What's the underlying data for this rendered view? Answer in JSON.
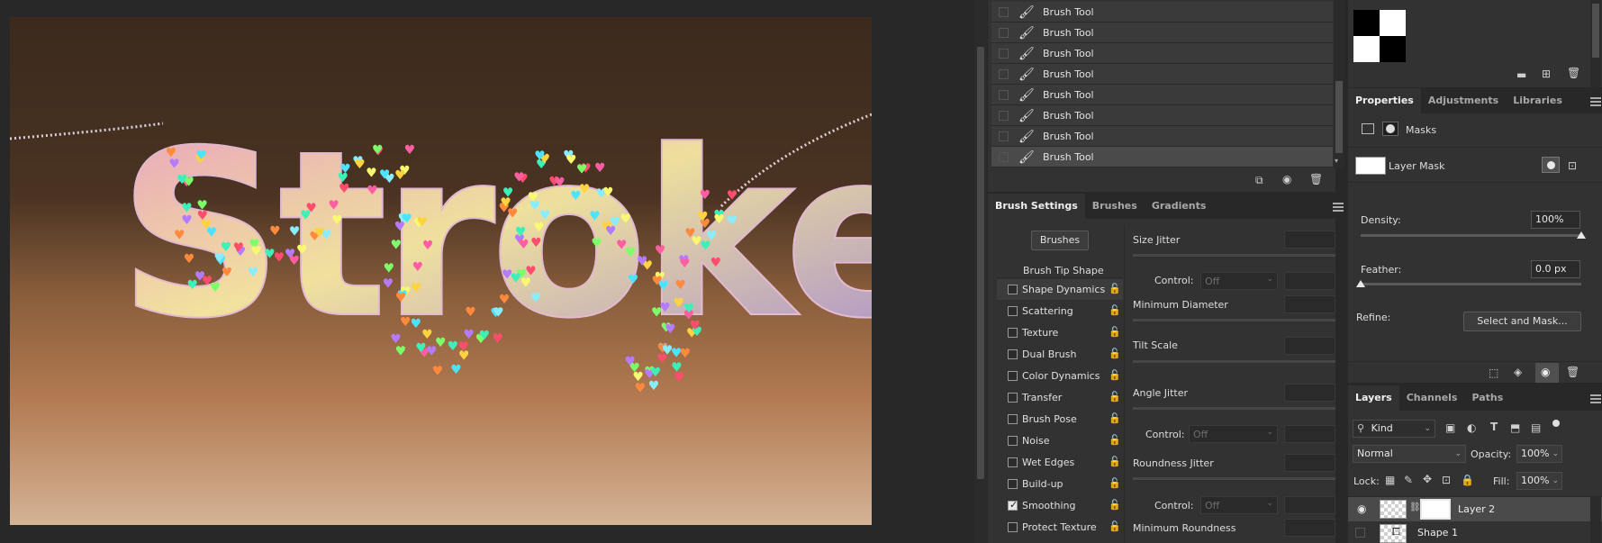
{
  "canvas": {
    "artwork_text": "Stroke"
  },
  "history": {
    "items": [
      {
        "label": "Brush Tool"
      },
      {
        "label": "Brush Tool"
      },
      {
        "label": "Brush Tool"
      },
      {
        "label": "Brush Tool"
      },
      {
        "label": "Brush Tool"
      },
      {
        "label": "Brush Tool"
      },
      {
        "label": "Brush Tool"
      },
      {
        "label": "Brush Tool"
      }
    ]
  },
  "brush_panel": {
    "tabs": [
      "Brush Settings",
      "Brushes",
      "Gradients"
    ],
    "brushes_button": "Brushes",
    "tip_shape": "Brush Tip Shape",
    "options": [
      {
        "label": "Shape Dynamics",
        "checked": false
      },
      {
        "label": "Scattering",
        "checked": false
      },
      {
        "label": "Texture",
        "checked": false
      },
      {
        "label": "Dual Brush",
        "checked": false
      },
      {
        "label": "Color Dynamics",
        "checked": false
      },
      {
        "label": "Transfer",
        "checked": false
      },
      {
        "label": "Brush Pose",
        "checked": false
      },
      {
        "label": "Noise",
        "checked": false
      },
      {
        "label": "Wet Edges",
        "checked": false
      },
      {
        "label": "Build-up",
        "checked": false
      },
      {
        "label": "Smoothing",
        "checked": true
      },
      {
        "label": "Protect Texture",
        "checked": false
      }
    ],
    "size_jitter": "Size Jitter",
    "control_label": "Control:",
    "control_value": "Off",
    "min_diameter": "Minimum Diameter",
    "tilt_scale": "Tilt Scale",
    "angle_jitter": "Angle Jitter",
    "roundness_jitter": "Roundness Jitter",
    "min_roundness": "Minimum Roundness"
  },
  "properties": {
    "tabs": [
      "Properties",
      "Adjustments",
      "Libraries"
    ],
    "masks_label": "Masks",
    "layer_mask_label": "Layer Mask",
    "density_label": "Density:",
    "density_value": "100%",
    "density_level": 1.0,
    "feather_label": "Feather:",
    "feather_value": "0.0 px",
    "feather_level": 0.0,
    "refine_label": "Refine:",
    "select_mask_button": "Select and Mask..."
  },
  "layers": {
    "tabs": [
      "Layers",
      "Channels",
      "Paths"
    ],
    "filter_kind": "Kind",
    "blend_mode": "Normal",
    "opacity_label": "Opacity:",
    "opacity_value": "100%",
    "lock_label": "Lock:",
    "fill_label": "Fill:",
    "fill_value": "100%",
    "items": [
      {
        "name": "Layer 2"
      },
      {
        "name": "Shape 1"
      }
    ]
  }
}
